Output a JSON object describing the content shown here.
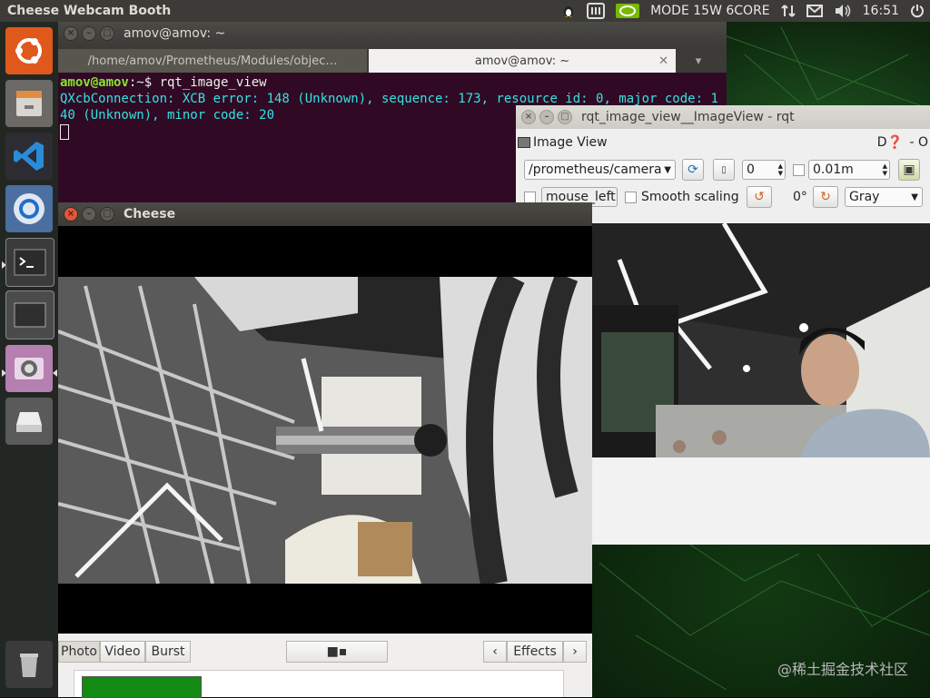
{
  "topbar": {
    "app_title": "Cheese Webcam Booth",
    "power_mode": "MODE 15W 6CORE",
    "clock": "16:51",
    "icons": [
      "tux-icon",
      "keyboard-icon",
      "nvidia-icon",
      "network-icon",
      "mail-icon",
      "volume-icon",
      "power-icon"
    ]
  },
  "launcher": {
    "items": [
      "ubuntu-icon",
      "files-icon",
      "vscode-icon",
      "chromium-icon",
      "terminal-icon",
      "workspace-icon",
      "cheese-icon",
      "drive-icon",
      "trash-icon"
    ]
  },
  "terminal": {
    "title": "amov@amov: ~",
    "tabs": [
      "/home/amov/Prometheus/Modules/objec…",
      "amov@amov: ~"
    ],
    "prompt_user": "amov@amov",
    "prompt_path": ":~$ ",
    "command": "rqt_image_view",
    "output": "QXcbConnection: XCB error: 148 (Unknown), sequence: 173, resource id: 0, major code: 140 (Unknown), minor code: 20"
  },
  "rqt": {
    "title": "rqt_image_view__ImageView - rqt",
    "plugin_label": "Image View",
    "plugin_help": "D❓",
    "plugin_close": "- O",
    "topic": "/prometheus/camera",
    "spin_value": "0",
    "zoom_value": "0.01m",
    "mouse_label": "mouse_left",
    "smooth_label": "Smooth scaling",
    "rotation": "0°",
    "color_mode": "Gray"
  },
  "cheese": {
    "title": "Cheese",
    "tabs": [
      "Photo",
      "Video",
      "Burst"
    ],
    "effects_label": "Effects",
    "prev_symbol": "‹",
    "next_symbol": "›"
  },
  "watermark": "@稀土掘金技术社区"
}
